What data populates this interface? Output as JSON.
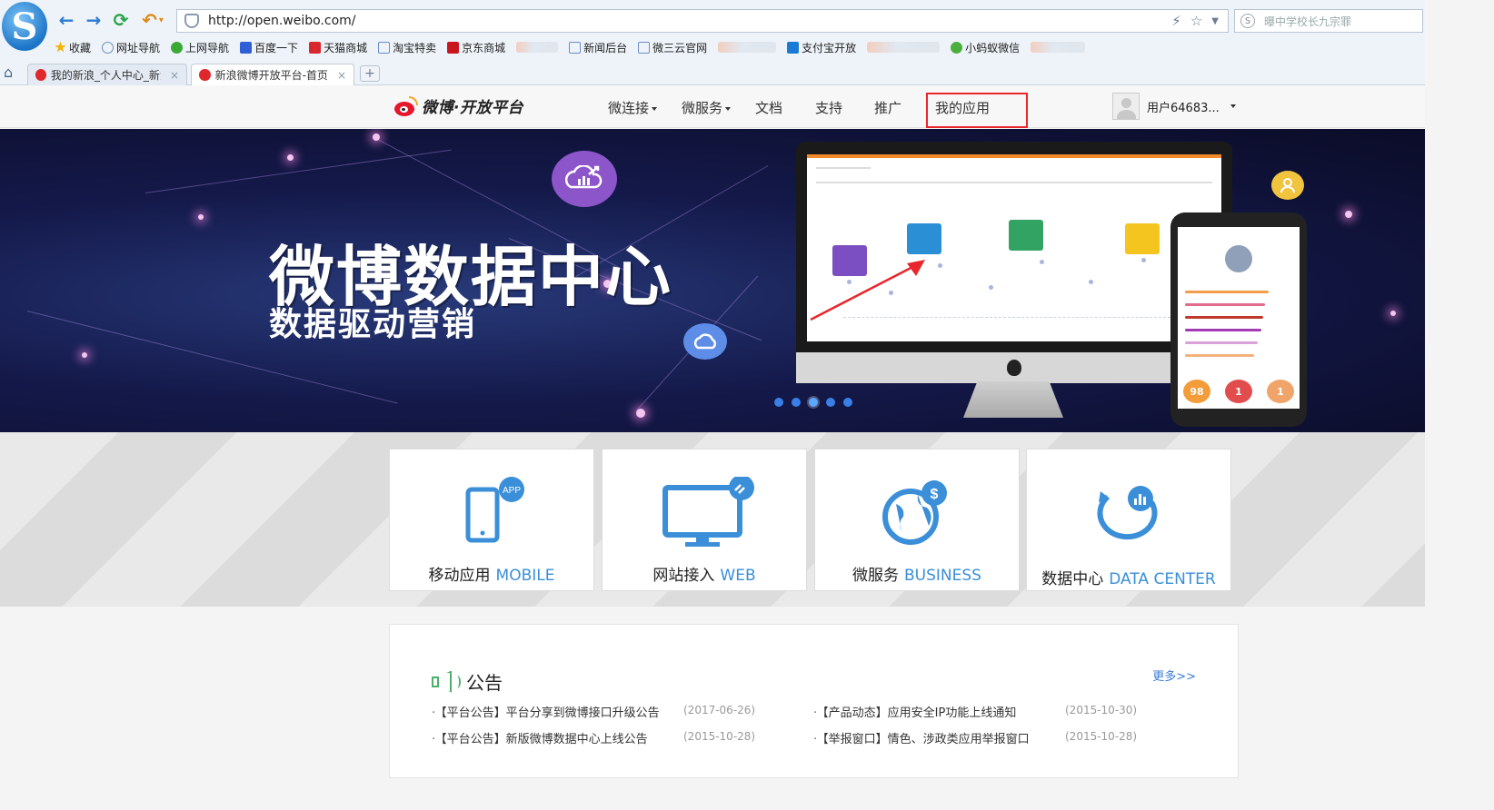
{
  "browser": {
    "logo_letter": "S",
    "url": "http://open.weibo.com/",
    "search_placeholder": "曝中学校长九宗罪",
    "bookmarks": [
      {
        "label": "收藏",
        "color": "#f5b400"
      },
      {
        "label": "网址导航",
        "color": "#6b8fb8"
      },
      {
        "label": "上网导航",
        "color": "#3aaa35"
      },
      {
        "label": "百度一下",
        "color": "#2f5fd6"
      },
      {
        "label": "天猫商城",
        "color": "#d9272e"
      },
      {
        "label": "淘宝特卖",
        "color": "#6a8dc4"
      },
      {
        "label": "京东商城",
        "color": "#c9151e"
      },
      {
        "label": "新闻后台",
        "color": "#6a8dc4"
      },
      {
        "label": "微三云官网",
        "color": "#6a8dc4"
      },
      {
        "label": "支付宝开放",
        "color": "#1a7bd5"
      },
      {
        "label": "小蚂蚁微信",
        "color": "#4caf3c"
      }
    ],
    "tabs": [
      {
        "label": "我的新浪_个人中心_新浪",
        "close": "×"
      },
      {
        "label": "新浪微博开放平台-首页",
        "close": "×"
      }
    ],
    "new_tab": "+"
  },
  "header": {
    "logo_text": "微博·开放平台",
    "nav": [
      {
        "label": "微连接",
        "dropdown": true
      },
      {
        "label": "微服务",
        "dropdown": true
      },
      {
        "label": "文档",
        "dropdown": false
      },
      {
        "label": "支持",
        "dropdown": false
      },
      {
        "label": "推广",
        "dropdown": false
      },
      {
        "label": "我的应用",
        "dropdown": false
      }
    ],
    "username": "用户64683..."
  },
  "banner": {
    "title": "微博数据中心",
    "subtitle": "数据驱动营销",
    "phone_bubbles": [
      "98",
      "1",
      "1"
    ],
    "slide_count": 5,
    "active_slide": 3
  },
  "services": [
    {
      "cn": "移动应用",
      "en": "MOBILE",
      "icon": "mobile-app-icon",
      "badge": "APP"
    },
    {
      "cn": "网站接入",
      "en": "WEB",
      "icon": "web-monitor-icon"
    },
    {
      "cn": "微服务",
      "en": "BUSINESS",
      "icon": "globe-dollar-icon",
      "badge": "$"
    },
    {
      "cn": "数据中心",
      "en": "DATA CENTER",
      "icon": "data-cloud-icon"
    }
  ],
  "notices": {
    "title": "公告",
    "more": "更多>>",
    "items": [
      {
        "text": "【平台公告】平台分享到微博接口升级公告",
        "date": "(2017-06-26)"
      },
      {
        "text": "【产品动态】应用安全IP功能上线通知",
        "date": "(2015-10-30)"
      },
      {
        "text": "【平台公告】新版微博数据中心上线公告",
        "date": "(2015-10-28)"
      },
      {
        "text": "【举报窗口】情色、涉政类应用举报窗口",
        "date": "(2015-10-28)"
      }
    ]
  },
  "colors": {
    "accent": "#3a8fd8",
    "highlight": "#e8262c",
    "weibo_red": "#e6162d"
  }
}
